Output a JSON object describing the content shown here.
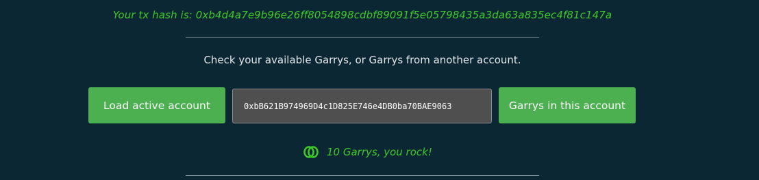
{
  "tx_hash_text": "Your tx hash is: 0xb4d4a7e9b96e26ff8054898cdbf89091f5e05798435a3da63a835ec4f81c147a",
  "prompt_text": "Check your available Garrys, or Garrys from another account.",
  "load_button_label": "Load active account",
  "address_input_value": "0xbB621B974969D4c1D825E746e4DB0ba70BAE9063",
  "garrys_button_label": "Garrys in this account",
  "result": {
    "icon": "garry-coin-icon",
    "text": "10 Garrys, you rock!"
  },
  "colors": {
    "background": "#0b2733",
    "accent_green": "#3ec928",
    "button_green": "#4caf50",
    "input_bg": "#4f4f4f"
  }
}
